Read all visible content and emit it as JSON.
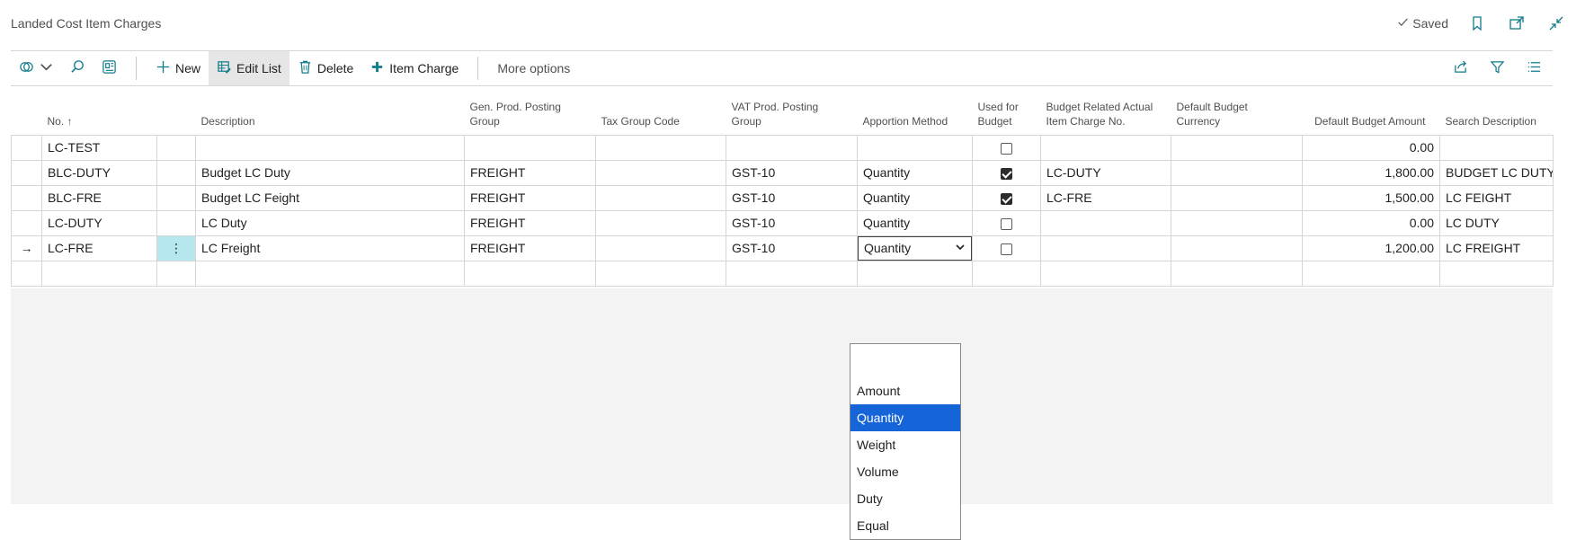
{
  "header": {
    "title": "Landed Cost Item Charges",
    "saved_label": "Saved"
  },
  "toolbar": {
    "new_label": "New",
    "edit_list_label": "Edit List",
    "delete_label": "Delete",
    "item_charge_label": "Item Charge",
    "more_options_label": "More options"
  },
  "columns": [
    {
      "line1": "",
      "line2": "No. ↑"
    },
    {
      "line1": "",
      "line2": ""
    },
    {
      "line1": "",
      "line2": "Description"
    },
    {
      "line1": "Gen. Prod. Posting",
      "line2": "Group"
    },
    {
      "line1": "",
      "line2": "Tax Group Code"
    },
    {
      "line1": "VAT Prod. Posting",
      "line2": "Group"
    },
    {
      "line1": "",
      "line2": "Apportion Method"
    },
    {
      "line1": "Used for",
      "line2": "Budget"
    },
    {
      "line1": "Budget Related Actual",
      "line2": "Item Charge No."
    },
    {
      "line1": "Default Budget",
      "line2": "Currency"
    },
    {
      "line1": "",
      "line2": "Default Budget Amount"
    },
    {
      "line1": "",
      "line2": "Search Description"
    }
  ],
  "rows": [
    {
      "no": "LC-TEST",
      "description": "",
      "gen_prod": "",
      "tax_group": "",
      "vat_prod": "",
      "apportion": "",
      "used_for_budget": false,
      "related_no": "",
      "currency": "",
      "amount": "0.00",
      "search": ""
    },
    {
      "no": "BLC-DUTY",
      "description": "Budget LC Duty",
      "gen_prod": "FREIGHT",
      "tax_group": "",
      "vat_prod": "GST-10",
      "apportion": "Quantity",
      "used_for_budget": true,
      "related_no": "LC-DUTY",
      "currency": "",
      "amount": "1,800.00",
      "search": "BUDGET LC DUTY"
    },
    {
      "no": "BLC-FRE",
      "description": "Budget LC Feight",
      "gen_prod": "FREIGHT",
      "tax_group": "",
      "vat_prod": "GST-10",
      "apportion": "Quantity",
      "used_for_budget": true,
      "related_no": "LC-FRE",
      "currency": "",
      "amount": "1,500.00",
      "search": "LC FEIGHT"
    },
    {
      "no": "LC-DUTY",
      "description": "LC Duty",
      "gen_prod": "FREIGHT",
      "tax_group": "",
      "vat_prod": "GST-10",
      "apportion": "Quantity",
      "used_for_budget": false,
      "related_no": "",
      "currency": "",
      "amount": "0.00",
      "search": "LC DUTY"
    },
    {
      "no": "LC-FRE",
      "description": "LC Freight",
      "gen_prod": "FREIGHT",
      "tax_group": "",
      "vat_prod": "GST-10",
      "apportion": "Quantity",
      "used_for_budget": false,
      "related_no": "",
      "currency": "",
      "amount": "1,200.00",
      "search": "LC FREIGHT"
    }
  ],
  "current_row_marker": "→",
  "row_menu_glyph": "⋮",
  "apportion_dropdown": {
    "options": [
      "",
      "Amount",
      "Quantity",
      "Weight",
      "Volume",
      "Duty",
      "Equal"
    ],
    "selected": "Quantity"
  },
  "colors": {
    "accent": "#0f7b8a",
    "selected_option": "#1565d8",
    "row_menu_cell": "#b6e7ee"
  }
}
